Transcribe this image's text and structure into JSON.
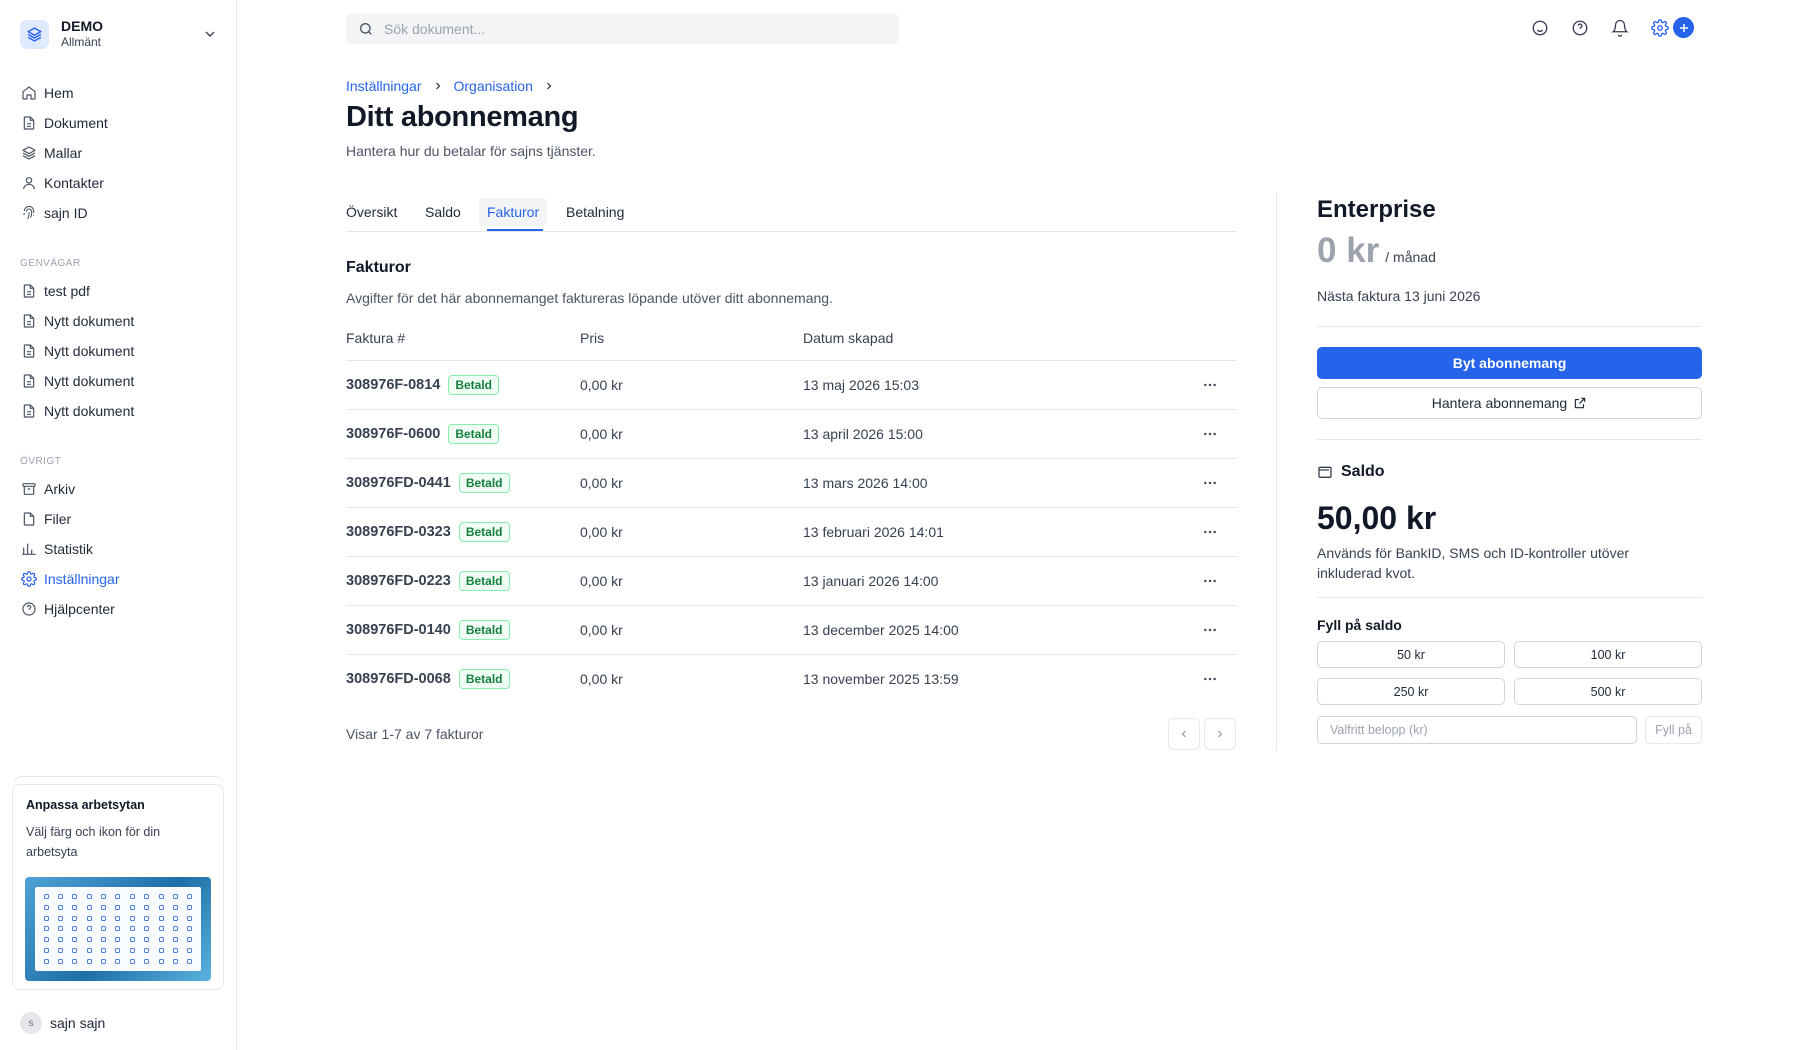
{
  "workspace": {
    "name": "DEMO",
    "subtitle": "Allmänt"
  },
  "sidebar": {
    "main": [
      {
        "label": "Hem",
        "icon": "home-icon"
      },
      {
        "label": "Dokument",
        "icon": "document-icon"
      },
      {
        "label": "Mallar",
        "icon": "layers-icon"
      },
      {
        "label": "Kontakter",
        "icon": "user-icon"
      },
      {
        "label": "sajn ID",
        "icon": "fingerprint-icon"
      }
    ],
    "shortcuts_label": "GENVÄGAR",
    "shortcuts": [
      {
        "label": "test pdf"
      },
      {
        "label": "Nytt dokument"
      },
      {
        "label": "Nytt dokument"
      },
      {
        "label": "Nytt dokument"
      },
      {
        "label": "Nytt dokument"
      }
    ],
    "other_label": "ÖVRIGT",
    "other": [
      {
        "label": "Arkiv",
        "icon": "archive-icon"
      },
      {
        "label": "Filer",
        "icon": "file-icon"
      },
      {
        "label": "Statistik",
        "icon": "chart-icon"
      },
      {
        "label": "Inställningar",
        "icon": "gear-icon",
        "active": true
      },
      {
        "label": "Hjälpcenter",
        "icon": "help-icon"
      }
    ],
    "promo": {
      "title": "Anpassa arbetsytan",
      "text": "Välj färg och ikon för din arbetsyta"
    },
    "user": {
      "initial": "s",
      "name": "sajn sajn"
    }
  },
  "search": {
    "placeholder": "Sök dokument..."
  },
  "breadcrumb": [
    "Inställningar",
    "Organisation"
  ],
  "page": {
    "title": "Ditt abonnemang",
    "subtitle": "Hantera hur du betalar för sajns tjänster."
  },
  "tabs": [
    "Översikt",
    "Saldo",
    "Fakturor",
    "Betalning"
  ],
  "active_tab": "Fakturor",
  "invoices": {
    "title": "Fakturor",
    "description": "Avgifter för det här abonnemanget faktureras löpande utöver ditt abonnemang.",
    "columns": [
      "Faktura #",
      "Pris",
      "Datum skapad"
    ],
    "rows": [
      {
        "number": "308976F-0814",
        "status": "Betald",
        "price": "0,00 kr",
        "date": "13 maj 2026 15:03"
      },
      {
        "number": "308976F-0600",
        "status": "Betald",
        "price": "0,00 kr",
        "date": "13 april 2026 15:00"
      },
      {
        "number": "308976FD-0441",
        "status": "Betald",
        "price": "0,00 kr",
        "date": "13 mars 2026 14:00"
      },
      {
        "number": "308976FD-0323",
        "status": "Betald",
        "price": "0,00 kr",
        "date": "13 februari 2026 14:01"
      },
      {
        "number": "308976FD-0223",
        "status": "Betald",
        "price": "0,00 kr",
        "date": "13 januari 2026 14:00"
      },
      {
        "number": "308976FD-0140",
        "status": "Betald",
        "price": "0,00 kr",
        "date": "13 december 2025 14:00"
      },
      {
        "number": "308976FD-0068",
        "status": "Betald",
        "price": "0,00 kr",
        "date": "13 november 2025 13:59"
      }
    ],
    "footer": "Visar 1-7 av 7 fakturor"
  },
  "plan": {
    "name": "Enterprise",
    "price": "0 kr",
    "period": "/ månad",
    "next_invoice": "Nästa faktura 13 juni 2026",
    "change_button": "Byt abonnemang",
    "manage_button": "Hantera abonnemang"
  },
  "balance": {
    "title": "Saldo",
    "amount": "50,00 kr",
    "description": "Används för BankID, SMS och ID-kontroller utöver inkluderad kvot.",
    "topup_title": "Fyll på saldo",
    "amounts": [
      "50 kr",
      "100 kr",
      "250 kr",
      "500 kr"
    ],
    "custom_placeholder": "Valfritt belopp (kr)",
    "topup_button": "Fyll på"
  },
  "colors": {
    "accent": "#2563eb",
    "paid_green": "#15803d",
    "border": "#e5e7eb"
  }
}
